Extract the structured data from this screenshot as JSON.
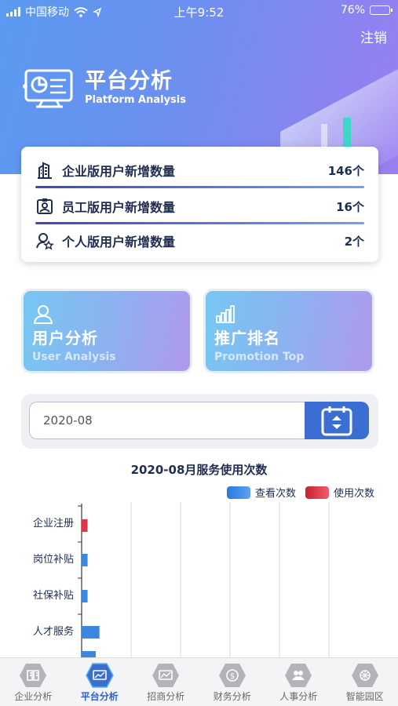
{
  "status_bar": {
    "carrier": "中国移动",
    "time": "上午9:52",
    "battery": "76%",
    "battery_level": 0.76
  },
  "header": {
    "logout_label": "注销",
    "title": "平台分析",
    "subtitle": "Platform Analysis"
  },
  "stats": [
    {
      "icon": "building-icon",
      "label": "企业版用户新增数量",
      "value": "146个"
    },
    {
      "icon": "employee-badge-icon",
      "label": "员工版用户新增数量",
      "value": "16个"
    },
    {
      "icon": "person-star-icon",
      "label": "个人版用户新增数量",
      "value": "2个"
    }
  ],
  "tiles": {
    "user": {
      "title": "用户分析",
      "subtitle": "User Analysis"
    },
    "promotion": {
      "title": "推广排名",
      "subtitle": "Promotion Top"
    }
  },
  "date_picker": {
    "value": "2020-08"
  },
  "chart_data": {
    "type": "bar",
    "title": "2020-08月服务使用次数",
    "orientation": "horizontal",
    "categories": [
      "企业注册",
      "岗位补贴",
      "社保补贴",
      "人才服务"
    ],
    "series": [
      {
        "name": "查看次数",
        "color": "#3a86e0",
        "values": [
          0,
          1,
          1,
          3
        ]
      },
      {
        "name": "使用次数",
        "color": "#e0364a",
        "values": [
          1,
          0,
          0,
          0
        ]
      }
    ],
    "xlim": [
      0,
      50
    ],
    "grid": true,
    "legend_position": "top-right"
  },
  "tabbar": {
    "active": 1,
    "items": [
      {
        "label": "企业分析",
        "icon": "enterprise-analysis-icon"
      },
      {
        "label": "平台分析",
        "icon": "platform-analysis-icon"
      },
      {
        "label": "招商分析",
        "icon": "investment-analysis-icon"
      },
      {
        "label": "财务分析",
        "icon": "finance-analysis-icon"
      },
      {
        "label": "人事分析",
        "icon": "hr-analysis-icon"
      },
      {
        "label": "智能园区",
        "icon": "smart-park-icon"
      }
    ]
  }
}
